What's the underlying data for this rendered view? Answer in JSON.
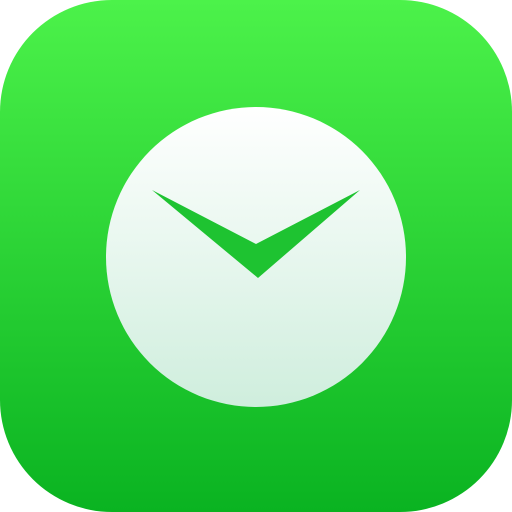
{
  "app_icon": {
    "icon": "envelope-checkmark-icon",
    "colors": {
      "background_top": "#4cf24a",
      "background_bottom": "#0ab321",
      "circle_top": "#ffffff",
      "circle_bottom": "#cfeedd",
      "mark": "#1ec331"
    }
  }
}
